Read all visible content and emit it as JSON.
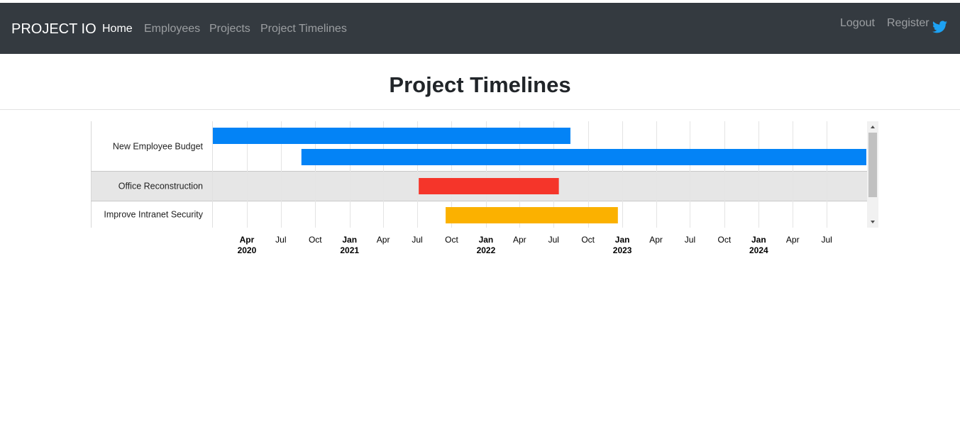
{
  "navbar": {
    "brand": "PROJECT IO",
    "links": [
      {
        "label": "Home",
        "active": true
      },
      {
        "label": "Employees",
        "active": false
      },
      {
        "label": "Projects",
        "active": false
      },
      {
        "label": "Project Timelines",
        "active": false
      }
    ],
    "right_links": [
      {
        "label": "Logout"
      },
      {
        "label": "Register"
      }
    ],
    "icon": "twitter-icon",
    "colors": {
      "background": "#343a40",
      "twitter": "#1da1f2"
    }
  },
  "page": {
    "title": "Project Timelines"
  },
  "chart_data": {
    "type": "timeline",
    "rows": [
      {
        "label": "New Employee Budget",
        "shaded": false
      },
      {
        "label": "Office Reconstruction",
        "shaded": true
      },
      {
        "label": "Improve Intranet Security",
        "shaded": false
      }
    ],
    "bars": [
      {
        "row": 0,
        "start": "2020-01-01",
        "end": "2022-08-15",
        "color": "#0383f6"
      },
      {
        "row": 0,
        "start": "2020-08-25",
        "end": "2024-10-15",
        "color": "#0383f6"
      },
      {
        "row": 1,
        "start": "2021-07-05",
        "end": "2022-07-15",
        "color": "#f5352a"
      },
      {
        "row": 2,
        "start": "2021-09-15",
        "end": "2022-12-20",
        "color": "#fbb100"
      }
    ],
    "x_ticks": [
      {
        "date": "2020-04-01",
        "label": "Apr",
        "year": "2020"
      },
      {
        "date": "2020-07-01",
        "label": "Jul",
        "year": ""
      },
      {
        "date": "2020-10-01",
        "label": "Oct",
        "year": ""
      },
      {
        "date": "2021-01-01",
        "label": "Jan",
        "year": "2021"
      },
      {
        "date": "2021-04-01",
        "label": "Apr",
        "year": ""
      },
      {
        "date": "2021-07-01",
        "label": "Jul",
        "year": ""
      },
      {
        "date": "2021-10-01",
        "label": "Oct",
        "year": ""
      },
      {
        "date": "2022-01-01",
        "label": "Jan",
        "year": "2022"
      },
      {
        "date": "2022-04-01",
        "label": "Apr",
        "year": ""
      },
      {
        "date": "2022-07-01",
        "label": "Jul",
        "year": ""
      },
      {
        "date": "2022-10-01",
        "label": "Oct",
        "year": ""
      },
      {
        "date": "2023-01-01",
        "label": "Jan",
        "year": "2023"
      },
      {
        "date": "2023-04-01",
        "label": "Apr",
        "year": ""
      },
      {
        "date": "2023-07-01",
        "label": "Jul",
        "year": ""
      },
      {
        "date": "2023-10-01",
        "label": "Oct",
        "year": ""
      },
      {
        "date": "2024-01-01",
        "label": "Jan",
        "year": "2024"
      },
      {
        "date": "2024-04-01",
        "label": "Apr",
        "year": ""
      },
      {
        "date": "2024-07-01",
        "label": "Jul",
        "year": ""
      }
    ],
    "grid": true
  }
}
